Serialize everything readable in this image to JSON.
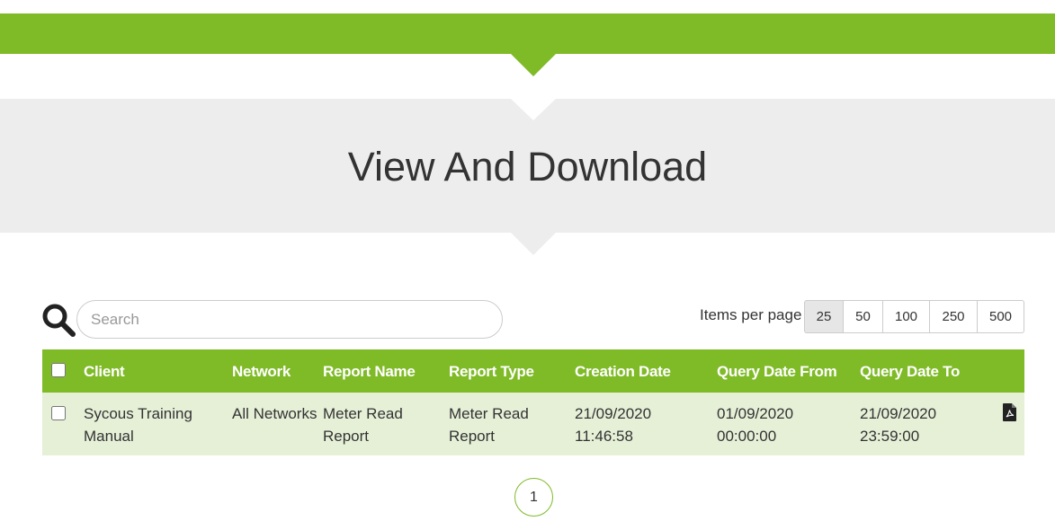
{
  "banner": {
    "title": "View And Download"
  },
  "search": {
    "placeholder": "Search",
    "value": ""
  },
  "items_per_page": {
    "label": "Items per page",
    "options": [
      "25",
      "50",
      "100",
      "250",
      "500"
    ],
    "selected": "25"
  },
  "table": {
    "headers": [
      "Client",
      "Network",
      "Report Name",
      "Report Type",
      "Creation Date",
      "Query Date From",
      "Query Date To"
    ],
    "rows": [
      {
        "client": "Sycous Training Manual",
        "network": "All Networks",
        "report_name": "Meter Read Report",
        "report_type": "Meter Read Report",
        "creation_date": "21/09/2020 11:46:58",
        "query_from": "01/09/2020 00:00:00",
        "query_to": "21/09/2020 23:59:00",
        "download_icon": "pdf-file-icon"
      }
    ]
  },
  "pagination": {
    "current_page": "1"
  },
  "colors": {
    "brand_green": "#7fba27",
    "row_bg": "#e6f0d7",
    "banner_bg": "#ededed"
  }
}
